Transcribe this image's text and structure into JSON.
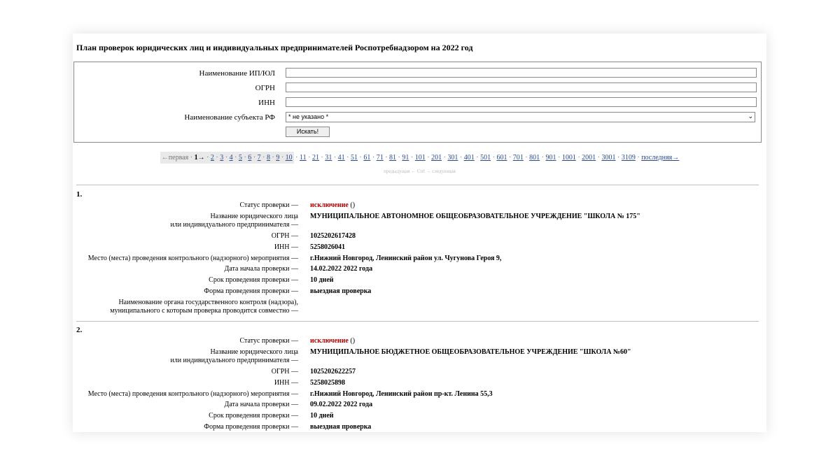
{
  "page": {
    "title": "План проверок юридических лиц и индивидуальных предпринимателей Роспотребнадзором на 2022 год"
  },
  "form": {
    "name_label": "Наименование ИП/ЮЛ",
    "ogrn_label": "ОГРН",
    "inn_label": "ИНН",
    "region_label": "Наименование субъекта РФ",
    "region_value": "* не указано *",
    "search_button": "Искать!"
  },
  "pager": {
    "first": "←первая",
    "current": "1→",
    "pages": [
      "2",
      "3",
      "4",
      "5",
      "6",
      "7",
      "8",
      "9",
      "10",
      "11",
      "21",
      "31",
      "41",
      "51",
      "61",
      "71",
      "81",
      "91",
      "101",
      "201",
      "301",
      "401",
      "501",
      "601",
      "701",
      "801",
      "901",
      "1001",
      "2001",
      "3001",
      "3109"
    ],
    "last": "последняя→",
    "hint": "предыдущая ← Ctrl → следующая"
  },
  "labels": {
    "status": "Статус проверки —",
    "name_line1": "Название юридического лица",
    "name_line2": "или индивидуального предпринимателя —",
    "ogrn": "ОГРН —",
    "inn": "ИНН —",
    "place": "Место (места) проведения контрольного (надзорного) мероприятия —",
    "start_date": "Дата начала проверки —",
    "duration": "Срок проведения проверки —",
    "form": "Форма проведения проверки —",
    "joint_line1": "Наименование органа государственного контроля (надзора),",
    "joint_line2": "муниципального с которым проверка проводится совместно —"
  },
  "records": [
    {
      "num": "1.",
      "status": "исключение",
      "status_extra": "()",
      "name": "МУНИЦИПАЛЬНОЕ АВТОНОМНОЕ ОБЩЕОБРАЗОВАТЕЛЬНОЕ УЧРЕЖДЕНИЕ \"ШКОЛА № 175\"",
      "ogrn": "1025202617428",
      "inn": "5258026041",
      "place": "г.Нижний Новгород, Ленинский район ул. Чугунова Героя 9,",
      "start_date": "14.02.2022 2022 года",
      "duration": "10 дней",
      "form": "выездная проверка"
    },
    {
      "num": "2.",
      "status": "исключение",
      "status_extra": "()",
      "name": "МУНИЦИПАЛЬНОЕ БЮДЖЕТНОЕ ОБЩЕОБРАЗОВАТЕЛЬНОЕ УЧРЕЖДЕНИЕ \"ШКОЛА №60\"",
      "ogrn": "1025202622257",
      "inn": "5258025898",
      "place": "г.Нижний Новгород, Ленинский район пр-кт. Ленина 55,3",
      "start_date": "09.02.2022 2022 года",
      "duration": "10 дней",
      "form": "выездная проверка"
    }
  ],
  "colors": {
    "status": "#b00000",
    "link": "#2a4a8a"
  }
}
